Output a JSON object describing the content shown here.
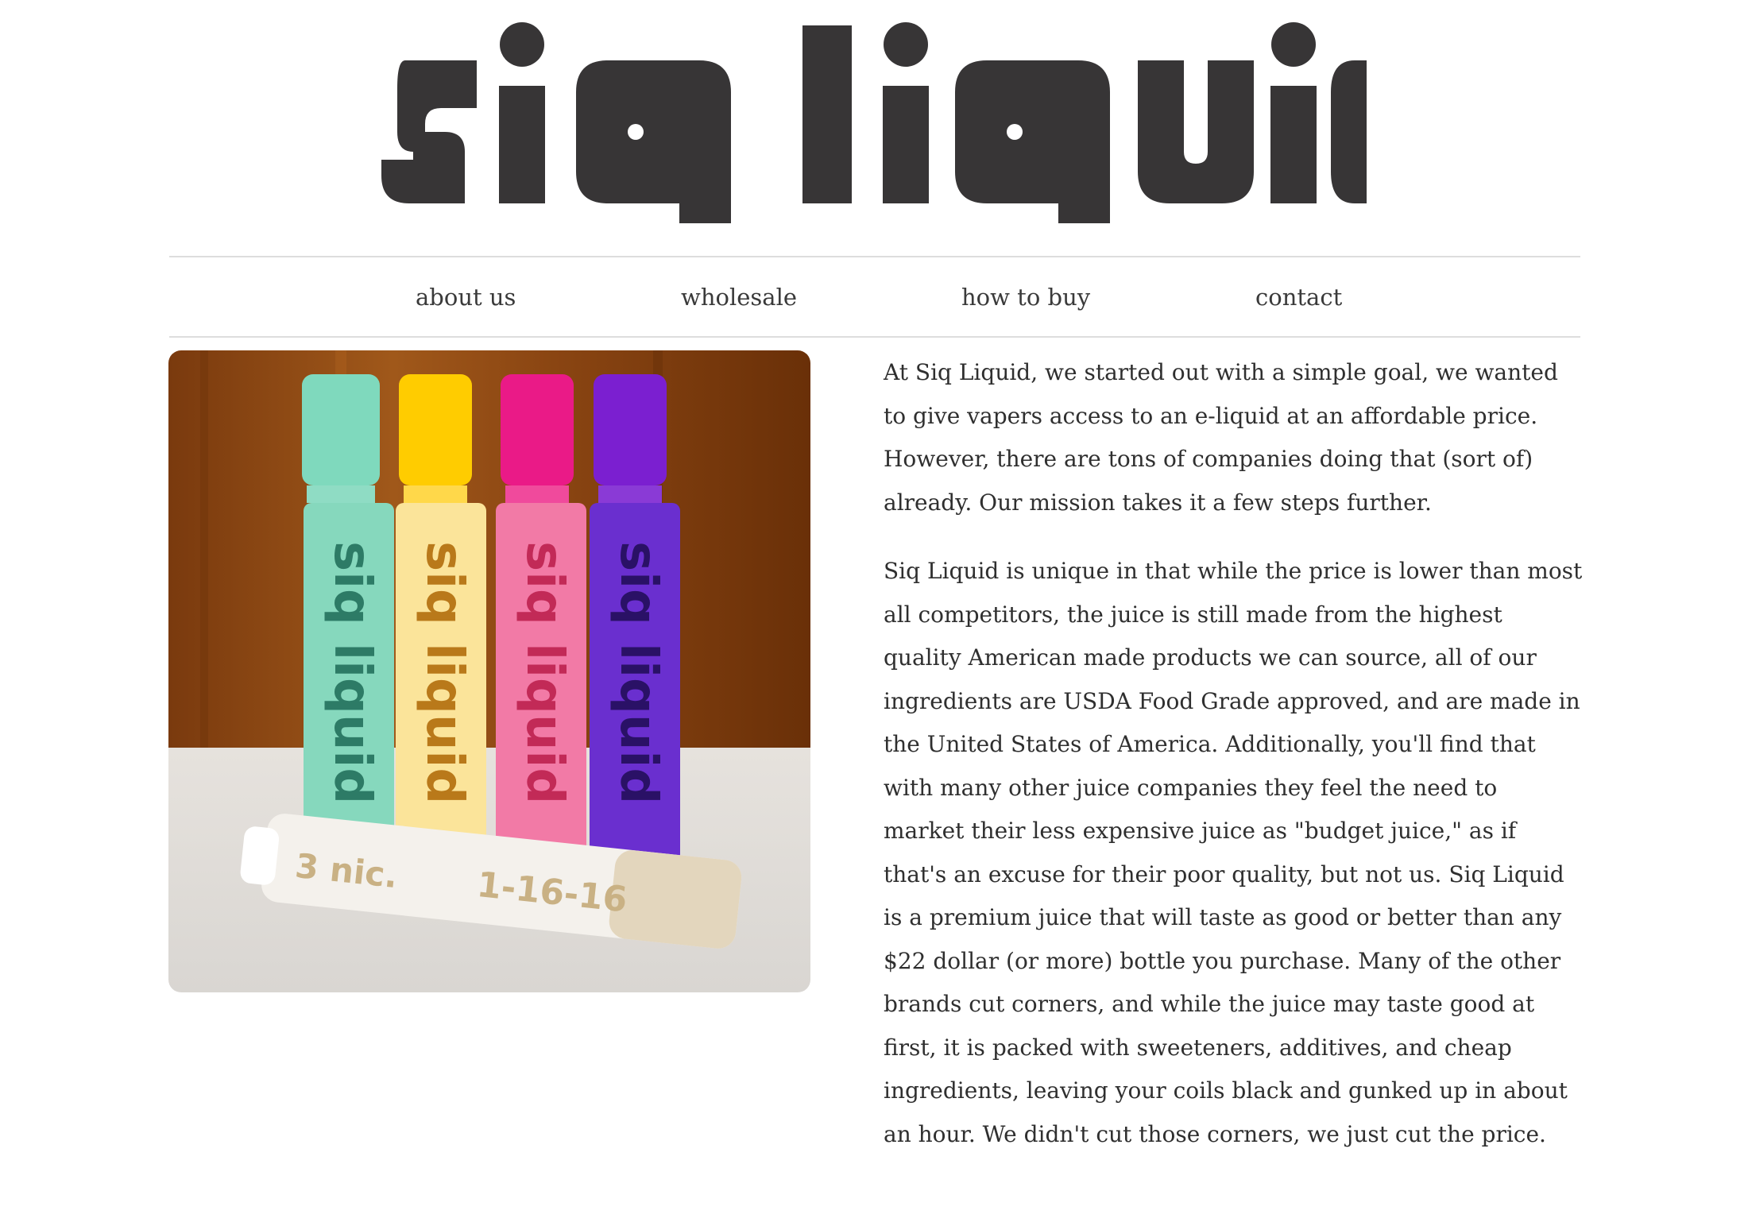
{
  "site": {
    "logo_text": "siq liquid"
  },
  "nav": {
    "items": [
      {
        "label": "about us"
      },
      {
        "label": "wholesale"
      },
      {
        "label": "how to buy"
      },
      {
        "label": "contact"
      }
    ]
  },
  "main": {
    "photo": {
      "bottle_label": "siq liquid",
      "tube_label_left": "3 nic.",
      "tube_label_right": "1-16-16",
      "bottle_colors": [
        "#86d8bd",
        "#fbe49a",
        "#f27aa6",
        "#6a2fcf"
      ],
      "cap_colors": [
        "#7fd9bd",
        "#ffcc00",
        "#ea1a87",
        "#7b1fd0"
      ]
    },
    "paragraphs": [
      "At Siq Liquid, we started out with a simple goal, we wanted to give vapers access to an e-liquid at an affordable price. However, there are tons of companies doing that (sort of) already. Our mission takes it a few steps further.",
      "Siq Liquid is unique in that while the price is lower than most all competitors, the juice is still made from the highest quality American made products we can source, all of our ingredients are USDA Food Grade approved, and are made in the United States of America. Additionally, you'll find that with many other juice companies they feel the need to market their less expensive juice as \"budget juice,\" as if that's an excuse for their poor quality, but not us. Siq Liquid is a premium juice that will taste as good or better than any $22 dollar (or more) bottle you purchase. Many of the other brands cut corners, and while the juice may taste good at first, it is packed with sweeteners, additives, and cheap ingredients, leaving your coils black and gunked up in about an hour. We didn't cut those corners, we just cut the price."
    ]
  }
}
